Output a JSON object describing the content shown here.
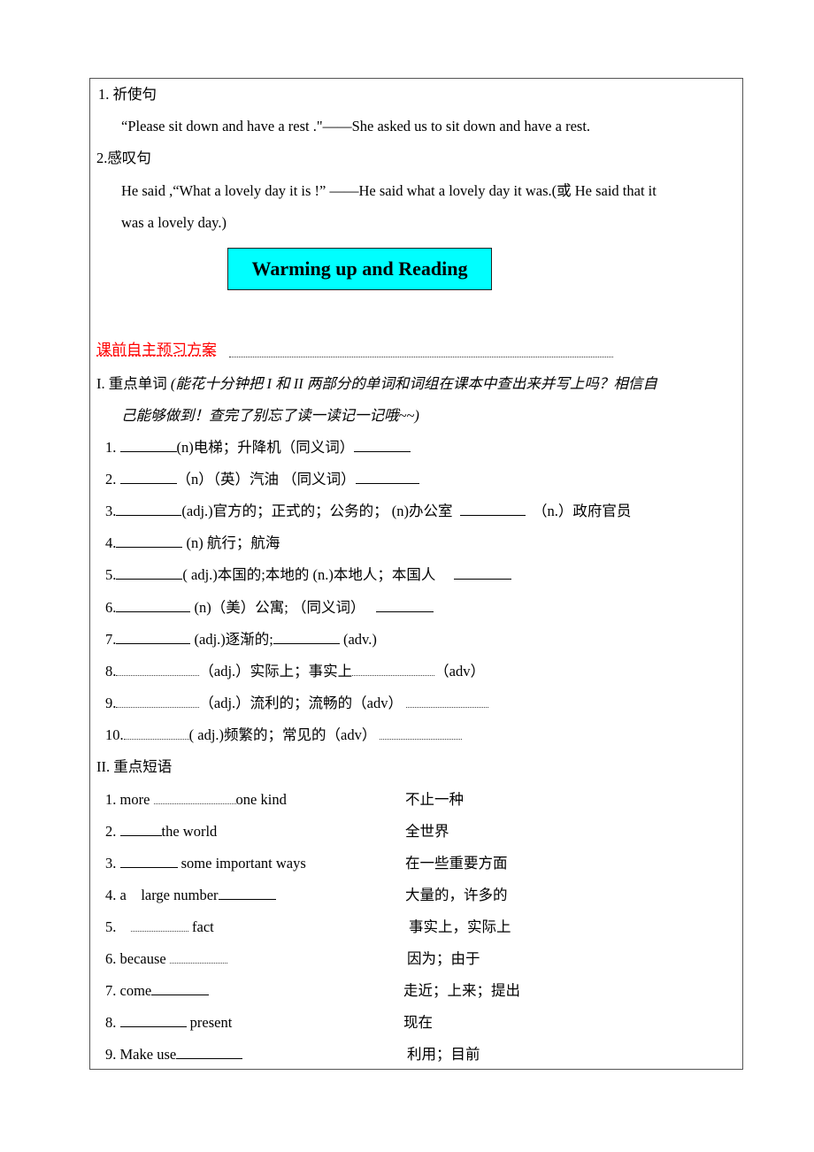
{
  "intro": {
    "item1_title": "1. 祈使句",
    "item1_example": "“Please sit down and have a rest .\"——She asked us to sit down and have a rest.",
    "item2_title": "2.感叹句",
    "item2_example_line1": "He said ,“What a lovely day it is !”    ——He said what a lovely day it was.(或 He said that it",
    "item2_example_line2": "was a lovely day.)"
  },
  "banner": {
    "title": "Warming up and Reading"
  },
  "preview": {
    "heading": "课前自主预习方案",
    "section1_title": "I. 重点单词",
    "section1_note_line1": "(能花十分钟把 I 和 II 两部分的单词和词组在课本中查出来并写上吗？相信自",
    "section1_note_line2": "己能够做到！查完了别忘了读一读记一记哦~~)",
    "words": [
      {
        "num": "1.",
        "text": "(n)电梯；升降机（同义词）"
      },
      {
        "num": "2.",
        "text": "（n）（英）汽油 （同义词）"
      },
      {
        "num": "3.",
        "text": "(adj.)官方的；正式的；公务的； (n)办公室",
        "tail": "（n.）政府官员"
      },
      {
        "num": "4.",
        "text": "(n) 航行；航海"
      },
      {
        "num": "5.",
        "text": "( adj.)本国的;本地的    (n.)本地人；本国人"
      },
      {
        "num": "6.",
        "text": "(n)（美）公寓; （同义词）"
      },
      {
        "num": "7.",
        "text": "(adj.)逐渐的;",
        "tail": "(adv.)"
      },
      {
        "num": "8.",
        "text": "（adj.）实际上；事实上",
        "tail": "（adv）"
      },
      {
        "num": "9.",
        "text": "（adj.）流利的；流畅的（adv）"
      },
      {
        "num": "10.",
        "text": "( adj.)频繁的；常见的（adv）"
      }
    ],
    "section2_title": "II. 重点短语",
    "phrases": [
      {
        "pre": "1. more ",
        "post": "one kind",
        "meaning": "不止一种"
      },
      {
        "pre": "2. ",
        "post": "the world",
        "meaning": "全世界"
      },
      {
        "pre": "3. ",
        "post": " some important ways",
        "meaning": "在一些重要方面"
      },
      {
        "pre": "4. a    large number",
        "post": "",
        "meaning": "大量的，许多的"
      },
      {
        "pre": "5.    ",
        "post": " fact",
        "meaning": "事实上，实际上"
      },
      {
        "pre": "6. because ",
        "post": "",
        "meaning": "因为；由于"
      },
      {
        "pre": "7. come",
        "post": "",
        "meaning": "走近；上来；提出"
      },
      {
        "pre": "8. ",
        "post": " present",
        "meaning": "现在"
      },
      {
        "pre": "9. Make use",
        "post": "",
        "meaning": "利用；目前"
      }
    ]
  }
}
